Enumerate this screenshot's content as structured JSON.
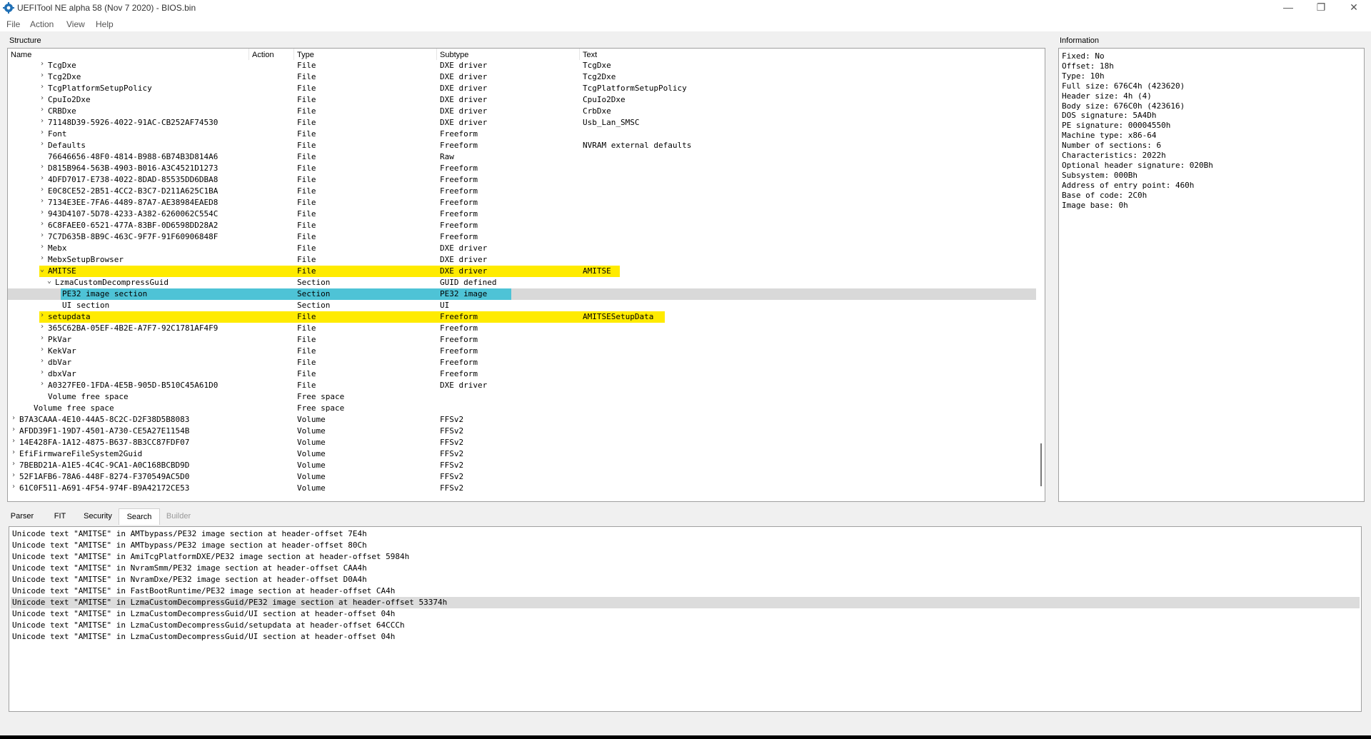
{
  "window": {
    "title": "UEFITool NE alpha 58 (Nov  7 2020) - BIOS.bin",
    "controls": [
      "—",
      "❐",
      "✕"
    ]
  },
  "menu": [
    "File",
    "Action",
    "View",
    "Help"
  ],
  "structure": {
    "title": "Structure",
    "columns": [
      "Name",
      "Action",
      "Type",
      "Subtype",
      "Text"
    ],
    "rows": [
      {
        "name": "TcgDxe",
        "type": "File",
        "subtype": "DXE driver",
        "text": "TcgDxe",
        "indent": 4,
        "exp": "collapsed"
      },
      {
        "name": "Tcg2Dxe",
        "type": "File",
        "subtype": "DXE driver",
        "text": "Tcg2Dxe",
        "indent": 4,
        "exp": "collapsed"
      },
      {
        "name": "TcgPlatformSetupPolicy",
        "type": "File",
        "subtype": "DXE driver",
        "text": "TcgPlatformSetupPolicy",
        "indent": 4,
        "exp": "collapsed"
      },
      {
        "name": "CpuIo2Dxe",
        "type": "File",
        "subtype": "DXE driver",
        "text": "CpuIo2Dxe",
        "indent": 4,
        "exp": "collapsed"
      },
      {
        "name": "CRBDxe",
        "type": "File",
        "subtype": "DXE driver",
        "text": "CrbDxe",
        "indent": 4,
        "exp": "collapsed"
      },
      {
        "name": "71148D39-5926-4022-91AC-CB252AF74530",
        "type": "File",
        "subtype": "DXE driver",
        "text": "Usb_Lan_SMSC",
        "indent": 4,
        "exp": "collapsed"
      },
      {
        "name": "Font",
        "type": "File",
        "subtype": "Freeform",
        "text": "",
        "indent": 4,
        "exp": "collapsed"
      },
      {
        "name": "Defaults",
        "type": "File",
        "subtype": "Freeform",
        "text": "NVRAM external defaults",
        "indent": 4,
        "exp": "collapsed"
      },
      {
        "name": "76646656-48F0-4814-B988-6B74B3D814A6",
        "type": "File",
        "subtype": "Raw",
        "text": "",
        "indent": 4,
        "exp": "none"
      },
      {
        "name": "D815B964-563B-4903-B016-A3C4521D1273",
        "type": "File",
        "subtype": "Freeform",
        "text": "",
        "indent": 4,
        "exp": "collapsed"
      },
      {
        "name": "4DFD7017-E738-4022-8DAD-85535DD6DBA8",
        "type": "File",
        "subtype": "Freeform",
        "text": "",
        "indent": 4,
        "exp": "collapsed"
      },
      {
        "name": "E0C8CE52-2B51-4CC2-B3C7-D211A625C1BA",
        "type": "File",
        "subtype": "Freeform",
        "text": "",
        "indent": 4,
        "exp": "collapsed"
      },
      {
        "name": "7134E3EE-7FA6-4489-87A7-AE38984EAED8",
        "type": "File",
        "subtype": "Freeform",
        "text": "",
        "indent": 4,
        "exp": "collapsed"
      },
      {
        "name": "943D4107-5D78-4233-A382-6260062C554C",
        "type": "File",
        "subtype": "Freeform",
        "text": "",
        "indent": 4,
        "exp": "collapsed"
      },
      {
        "name": "6C8FAEE0-6521-477A-83BF-0D6598DD28A2",
        "type": "File",
        "subtype": "Freeform",
        "text": "",
        "indent": 4,
        "exp": "collapsed"
      },
      {
        "name": "7C7D635B-8B9C-463C-9F7F-91F60906848F",
        "type": "File",
        "subtype": "Freeform",
        "text": "",
        "indent": 4,
        "exp": "collapsed"
      },
      {
        "name": "Mebx",
        "type": "File",
        "subtype": "DXE driver",
        "text": "",
        "indent": 4,
        "exp": "collapsed"
      },
      {
        "name": "MebxSetupBrowser",
        "type": "File",
        "subtype": "DXE driver",
        "text": "",
        "indent": 4,
        "exp": "collapsed"
      },
      {
        "name": "AMITSE",
        "type": "File",
        "subtype": "DXE driver",
        "text": "AMITSE",
        "indent": 4,
        "exp": "expanded",
        "hl": "yellow"
      },
      {
        "name": "LzmaCustomDecompressGuid",
        "type": "Section",
        "subtype": "GUID defined",
        "text": "",
        "indent": 5,
        "exp": "expanded"
      },
      {
        "name": "PE32 image section",
        "type": "Section",
        "subtype": "PE32 image",
        "text": "",
        "indent": 6,
        "exp": "none",
        "hl": "cyan",
        "selected": true
      },
      {
        "name": "UI section",
        "type": "Section",
        "subtype": "UI",
        "text": "",
        "indent": 6,
        "exp": "none"
      },
      {
        "name": "setupdata",
        "type": "File",
        "subtype": "Freeform",
        "text": "AMITSESetupData",
        "indent": 4,
        "exp": "collapsed",
        "hl": "yellow"
      },
      {
        "name": "365C62BA-05EF-4B2E-A7F7-92C1781AF4F9",
        "type": "File",
        "subtype": "Freeform",
        "text": "",
        "indent": 4,
        "exp": "collapsed"
      },
      {
        "name": "PkVar",
        "type": "File",
        "subtype": "Freeform",
        "text": "",
        "indent": 4,
        "exp": "collapsed"
      },
      {
        "name": "KekVar",
        "type": "File",
        "subtype": "Freeform",
        "text": "",
        "indent": 4,
        "exp": "collapsed"
      },
      {
        "name": "dbVar",
        "type": "File",
        "subtype": "Freeform",
        "text": "",
        "indent": 4,
        "exp": "collapsed"
      },
      {
        "name": "dbxVar",
        "type": "File",
        "subtype": "Freeform",
        "text": "",
        "indent": 4,
        "exp": "collapsed"
      },
      {
        "name": "A0327FE0-1FDA-4E5B-905D-B510C45A61D0",
        "type": "File",
        "subtype": "DXE driver",
        "text": "",
        "indent": 4,
        "exp": "collapsed"
      },
      {
        "name": "Volume free space",
        "type": "Free space",
        "subtype": "",
        "text": "",
        "indent": 4,
        "exp": "none"
      },
      {
        "name": "Volume free space",
        "type": "Free space",
        "subtype": "",
        "text": "",
        "indent": 2,
        "exp": "none"
      },
      {
        "name": "B7A3CAAA-4E10-44A5-8C2C-D2F38D5B8083",
        "type": "Volume",
        "subtype": "FFSv2",
        "text": "",
        "indent": 0,
        "exp": "collapsed"
      },
      {
        "name": "AFDD39F1-19D7-4501-A730-CE5A27E1154B",
        "type": "Volume",
        "subtype": "FFSv2",
        "text": "",
        "indent": 0,
        "exp": "collapsed"
      },
      {
        "name": "14E428FA-1A12-4875-B637-8B3CC87FDF07",
        "type": "Volume",
        "subtype": "FFSv2",
        "text": "",
        "indent": 0,
        "exp": "collapsed"
      },
      {
        "name": "EfiFirmwareFileSystem2Guid",
        "type": "Volume",
        "subtype": "FFSv2",
        "text": "",
        "indent": 0,
        "exp": "collapsed"
      },
      {
        "name": "7BEBD21A-A1E5-4C4C-9CA1-A0C168BCBD9D",
        "type": "Volume",
        "subtype": "FFSv2",
        "text": "",
        "indent": 0,
        "exp": "collapsed"
      },
      {
        "name": "52F1AFB6-78A6-448F-8274-F370549AC5D0",
        "type": "Volume",
        "subtype": "FFSv2",
        "text": "",
        "indent": 0,
        "exp": "collapsed"
      },
      {
        "name": "61C0F511-A691-4F54-974F-B9A42172CE53",
        "type": "Volume",
        "subtype": "FFSv2",
        "text": "",
        "indent": 0,
        "exp": "collapsed"
      }
    ]
  },
  "information": {
    "title": "Information",
    "lines": [
      "Fixed: No",
      "Offset: 18h",
      "Type: 10h",
      "Full size: 676C4h (423620)",
      "Header size: 4h (4)",
      "Body size: 676C0h (423616)",
      "DOS signature: 5A4Dh",
      "PE signature: 00004550h",
      "Machine type: x86-64",
      "Number of sections: 6",
      "Characteristics: 2022h",
      "Optional header signature: 020Bh",
      "Subsystem: 000Bh",
      "Address of entry point: 460h",
      "Base of code: 2C0h",
      "Image base: 0h"
    ]
  },
  "tabs": [
    {
      "label": "Parser",
      "state": "normal"
    },
    {
      "label": "FIT",
      "state": "normal"
    },
    {
      "label": "Security",
      "state": "normal"
    },
    {
      "label": "Search",
      "state": "active"
    },
    {
      "label": "Builder",
      "state": "disabled"
    }
  ],
  "search_results": [
    {
      "text": "Unicode text \"AMITSE\" in AMTbypass/PE32 image section at header-offset 7E4h"
    },
    {
      "text": "Unicode text \"AMITSE\" in AMTbypass/PE32 image section at header-offset 80Ch"
    },
    {
      "text": "Unicode text \"AMITSE\" in AmiTcgPlatformDXE/PE32 image section at header-offset 5984h"
    },
    {
      "text": "Unicode text \"AMITSE\" in NvramSmm/PE32 image section at header-offset CAA4h"
    },
    {
      "text": "Unicode text \"AMITSE\" in NvramDxe/PE32 image section at header-offset D0A4h"
    },
    {
      "text": "Unicode text \"AMITSE\" in FastBootRuntime/PE32 image section at header-offset CA4h"
    },
    {
      "text": "Unicode text \"AMITSE\" in LzmaCustomDecompressGuid/PE32 image section at header-offset 53374h",
      "selected": true
    },
    {
      "text": "Unicode text \"AMITSE\" in LzmaCustomDecompressGuid/UI section at header-offset 04h"
    },
    {
      "text": "Unicode text \"AMITSE\" in LzmaCustomDecompressGuid/setupdata at header-offset 64CCCh"
    },
    {
      "text": "Unicode text \"AMITSE\" in LzmaCustomDecompressGuid/UI section at header-offset 04h"
    }
  ],
  "colors": {
    "highlight_yellow": "#ffeb00",
    "highlight_cyan": "#4ec3d6",
    "selection_gray": "#d9d9d9",
    "app_icon": "#1f6fb5"
  }
}
